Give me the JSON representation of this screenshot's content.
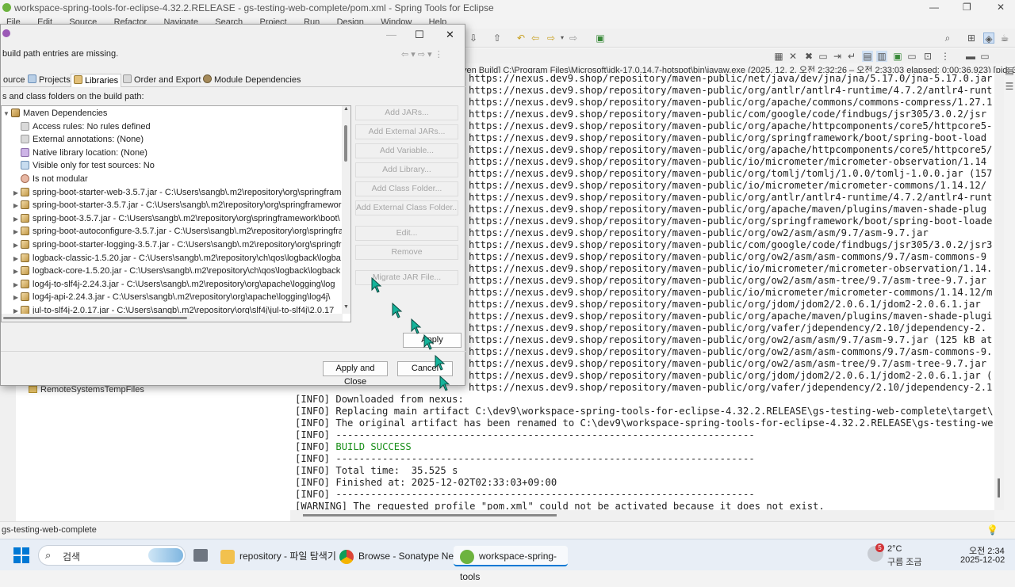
{
  "window": {
    "title": "workspace-spring-tools-for-eclipse-4.32.2.RELEASE - gs-testing-web-complete/pom.xml - Spring Tools for Eclipse",
    "minimize": "—",
    "maximize": "❐",
    "close": "✕"
  },
  "menu": [
    "File",
    "Edit",
    "Source",
    "Refactor",
    "Navigate",
    "Search",
    "Project",
    "Run",
    "Design",
    "Window",
    "Help"
  ],
  "console": {
    "info_line": "ven Build] C:\\Program Files\\Microsoft\\jdk-17.0.14.7-hotspot\\bin\\javaw.exe  (2025. 12. 2. 오전 2:32:26 – 오전 2:33:03 elapsed: 0:00:36.923) [pid: 3528",
    "lines": [
      "https://nexus.dev9.shop/repository/maven-public/net/java/dev/jna/jna/5.17.0/jna-5.17.0.jar",
      "https://nexus.dev9.shop/repository/maven-public/org/antlr/antlr4-runtime/4.7.2/antlr4-runt",
      "https://nexus.dev9.shop/repository/maven-public/org/apache/commons/commons-compress/1.27.1",
      "https://nexus.dev9.shop/repository/maven-public/com/google/code/findbugs/jsr305/3.0.2/jsr",
      "https://nexus.dev9.shop/repository/maven-public/org/apache/httpcomponents/core5/httpcore5-",
      "https://nexus.dev9.shop/repository/maven-public/org/springframework/boot/spring-boot-load",
      "https://nexus.dev9.shop/repository/maven-public/org/apache/httpcomponents/core5/httpcore5/",
      "https://nexus.dev9.shop/repository/maven-public/io/micrometer/micrometer-observation/1.14",
      "https://nexus.dev9.shop/repository/maven-public/org/tomlj/tomlj/1.0.0/tomlj-1.0.0.jar (157",
      "https://nexus.dev9.shop/repository/maven-public/io/micrometer/micrometer-commons/1.14.12/",
      "https://nexus.dev9.shop/repository/maven-public/org/antlr/antlr4-runtime/4.7.2/antlr4-runt",
      "https://nexus.dev9.shop/repository/maven-public/org/apache/maven/plugins/maven-shade-plug",
      "https://nexus.dev9.shop/repository/maven-public/org/springframework/boot/spring-boot-loade",
      "https://nexus.dev9.shop/repository/maven-public/org/ow2/asm/asm/9.7/asm-9.7.jar",
      "https://nexus.dev9.shop/repository/maven-public/com/google/code/findbugs/jsr305/3.0.2/jsr3",
      "https://nexus.dev9.shop/repository/maven-public/org/ow2/asm/asm-commons/9.7/asm-commons-9",
      "https://nexus.dev9.shop/repository/maven-public/io/micrometer/micrometer-observation/1.14.",
      "https://nexus.dev9.shop/repository/maven-public/org/ow2/asm/asm-tree/9.7/asm-tree-9.7.jar",
      "https://nexus.dev9.shop/repository/maven-public/io/micrometer/micrometer-commons/1.14.12/m",
      "https://nexus.dev9.shop/repository/maven-public/org/jdom/jdom2/2.0.6.1/jdom2-2.0.6.1.jar",
      "https://nexus.dev9.shop/repository/maven-public/org/apache/maven/plugins/maven-shade-plugi",
      "https://nexus.dev9.shop/repository/maven-public/org/vafer/jdependency/2.10/jdependency-2.",
      "https://nexus.dev9.shop/repository/maven-public/org/ow2/asm/asm/9.7/asm-9.7.jar (125 kB at",
      "https://nexus.dev9.shop/repository/maven-public/org/ow2/asm/asm-commons/9.7/asm-commons-9.",
      "https://nexus.dev9.shop/repository/maven-public/org/ow2/asm/asm-tree/9.7/asm-tree-9.7.jar",
      "https://nexus.dev9.shop/repository/maven-public/org/jdom/jdom2/2.0.6.1/jdom2-2.0.6.1.jar (",
      "https://nexus.dev9.shop/repository/maven-public/org/vafer/jdependency/2.10/jdependency-2.1",
      "[INFO] Downloaded from nexus:",
      "[INFO] Replacing main artifact C:\\dev9\\workspace-spring-tools-for-eclipse-4.32.2.RELEASE\\gs-testing-web-complete\\target\\",
      "[INFO] The original artifact has been renamed to C:\\dev9\\workspace-spring-tools-for-eclipse-4.32.2.RELEASE\\gs-testing-we",
      "[INFO] ------------------------------------------------------------------------",
      "[INFO] BUILD SUCCESS",
      "[INFO] ------------------------------------------------------------------------",
      "[INFO] Total time:  35.525 s",
      "[INFO] Finished at: 2025-12-02T02:33:03+09:00",
      "[INFO] ------------------------------------------------------------------------",
      "[WARNING] The requested profile \"pom.xml\" could not be activated because it does not exist."
    ],
    "success_prefix": "[INFO] ",
    "success_text": "BUILD SUCCESS"
  },
  "explorer": {
    "item": "RemoteSystemsTempFiles"
  },
  "status": {
    "selection": "gs-testing-web-complete"
  },
  "dialog": {
    "message": "build path entries are missing.",
    "nav": "⇦ ▾ ⇨ ▾  ⋮",
    "tabs": [
      "ource",
      "Projects",
      "Libraries",
      "Order and Export",
      "Module Dependencies"
    ],
    "active_tab": "Libraries",
    "tree_label": "s and class folders on the build path:",
    "tree": [
      {
        "label": "Maven Dependencies",
        "twisty": "v",
        "indent": 0,
        "icon": "lib"
      },
      {
        "label": "Access rules: No rules defined",
        "twisty": "",
        "indent": 1,
        "icon": "attr"
      },
      {
        "label": "External annotations: (None)",
        "twisty": "",
        "indent": 1,
        "icon": "attr"
      },
      {
        "label": "Native library location: (None)",
        "twisty": "",
        "indent": 1,
        "icon": "native"
      },
      {
        "label": "Visible only for test sources: No",
        "twisty": "",
        "indent": 1,
        "icon": "test"
      },
      {
        "label": "Is not modular",
        "twisty": "",
        "indent": 1,
        "icon": "mod"
      },
      {
        "label": "spring-boot-starter-web-3.5.7.jar - C:\\Users\\sangb\\.m2\\repository\\org\\springframe",
        "twisty": ">",
        "indent": 1,
        "icon": "jar"
      },
      {
        "label": "spring-boot-starter-3.5.7.jar - C:\\Users\\sangb\\.m2\\repository\\org\\springframework",
        "twisty": ">",
        "indent": 1,
        "icon": "jar"
      },
      {
        "label": "spring-boot-3.5.7.jar - C:\\Users\\sangb\\.m2\\repository\\org\\springframework\\boot\\",
        "twisty": ">",
        "indent": 1,
        "icon": "jar"
      },
      {
        "label": "spring-boot-autoconfigure-3.5.7.jar - C:\\Users\\sangb\\.m2\\repository\\org\\springframe",
        "twisty": ">",
        "indent": 1,
        "icon": "jar"
      },
      {
        "label": "spring-boot-starter-logging-3.5.7.jar - C:\\Users\\sangb\\.m2\\repository\\org\\springfr",
        "twisty": ">",
        "indent": 1,
        "icon": "jar"
      },
      {
        "label": "logback-classic-1.5.20.jar - C:\\Users\\sangb\\.m2\\repository\\ch\\qos\\logback\\logba",
        "twisty": ">",
        "indent": 1,
        "icon": "jar"
      },
      {
        "label": "logback-core-1.5.20.jar - C:\\Users\\sangb\\.m2\\repository\\ch\\qos\\logback\\logback",
        "twisty": ">",
        "indent": 1,
        "icon": "jar"
      },
      {
        "label": "log4j-to-slf4j-2.24.3.jar - C:\\Users\\sangb\\.m2\\repository\\org\\apache\\logging\\log",
        "twisty": ">",
        "indent": 1,
        "icon": "jar"
      },
      {
        "label": "log4j-api-2.24.3.jar - C:\\Users\\sangb\\.m2\\repository\\org\\apache\\logging\\log4j\\",
        "twisty": ">",
        "indent": 1,
        "icon": "jar"
      },
      {
        "label": "jul-to-slf4j-2.0.17.jar - C:\\Users\\sangb\\.m2\\repository\\org\\slf4j\\jul-to-slf4j\\2.0.17",
        "twisty": ">",
        "indent": 1,
        "icon": "jar"
      }
    ],
    "side_buttons": [
      "Add JARs...",
      "Add External JARs...",
      "Add Variable...",
      "Add Library...",
      "Add Class Folder...",
      "Add External Class Folder...",
      "Edit...",
      "Remove",
      "Migrate JAR File..."
    ],
    "apply": "Apply",
    "apply_close": "Apply and Close",
    "cancel": "Cancel"
  },
  "taskbar": {
    "search_placeholder": "검색",
    "items": [
      "repository - 파일 탐색기",
      "Browse - Sonatype Nexus",
      "workspace-spring-tools"
    ],
    "weather_temp": "2°C",
    "weather_text": "구름 조금",
    "weather_badge": "5",
    "time": "오전 2:34",
    "date": "2025-12-02"
  },
  "colors": {
    "success": "#1a8f1a",
    "accent": "#0078d4",
    "cursor_fill": "#14b39a"
  },
  "icons": [
    "windows-start-icon",
    "search-icon",
    "task-view-icon",
    "folder-icon",
    "chrome-icon",
    "spring-tools-icon",
    "weather-icon",
    "cursor-icon"
  ]
}
